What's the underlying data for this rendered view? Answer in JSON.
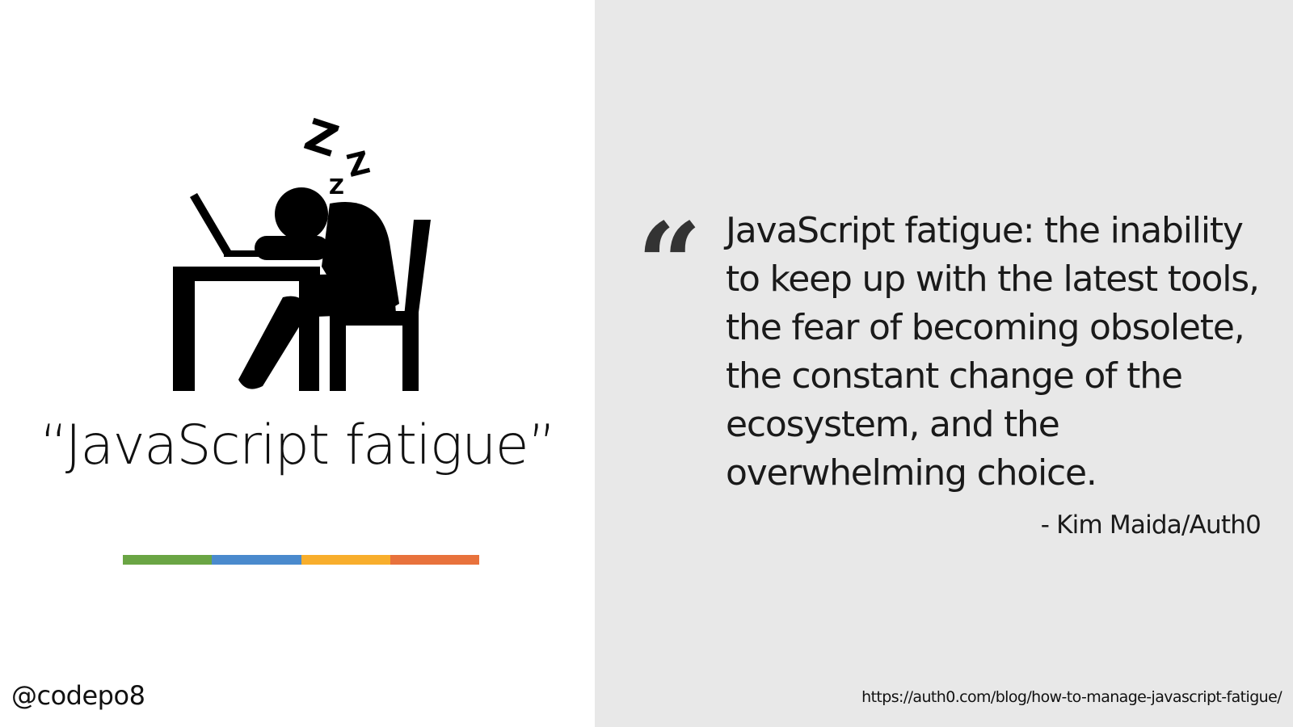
{
  "slide": {
    "title": "“JavaScript fatigue”",
    "handle": "@codepo8",
    "illustration_icon": "sleeping-person-at-desk-icon",
    "color_bar": [
      "#6aa544",
      "#4a8acd",
      "#f8ae2c",
      "#e8723c"
    ],
    "background_right": "#e8e8e8"
  },
  "quote": {
    "mark": "“",
    "text": "JavaScript fatigue: the inability to keep up with the latest tools, the fear of becoming obsolete, the constant change of the ecosystem, and the overwhelming choice.",
    "attribution": "- Kim Maida/Auth0",
    "source_url": "https://auth0.com/blog/how-to-manage-javascript-fatigue/"
  }
}
